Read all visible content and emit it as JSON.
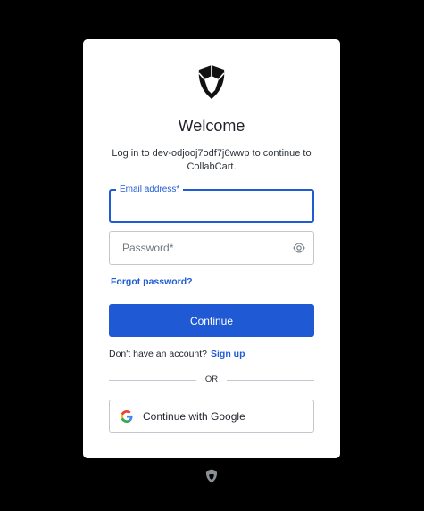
{
  "login": {
    "title": "Welcome",
    "subtitle": "Log in to dev-odjooj7odf7j6wwp to continue to CollabCart.",
    "email_label": "Email address*",
    "email_value": "",
    "password_placeholder": "Password*",
    "forgot_label": "Forgot password?",
    "continue_label": "Continue",
    "no_account_text": "Don't have an account?",
    "signup_label": "Sign up",
    "divider_text": "OR",
    "google_label": "Continue with Google"
  },
  "icons": {
    "brand": "shield-logo-icon",
    "password_toggle": "eye-icon",
    "google": "google-g-icon",
    "footer": "auth0-badge-icon"
  },
  "colors": {
    "background": "#000000",
    "card": "#ffffff",
    "accent": "#1e5bd4",
    "primary_button": "#1f5ad4",
    "border": "#c2c8d0"
  }
}
